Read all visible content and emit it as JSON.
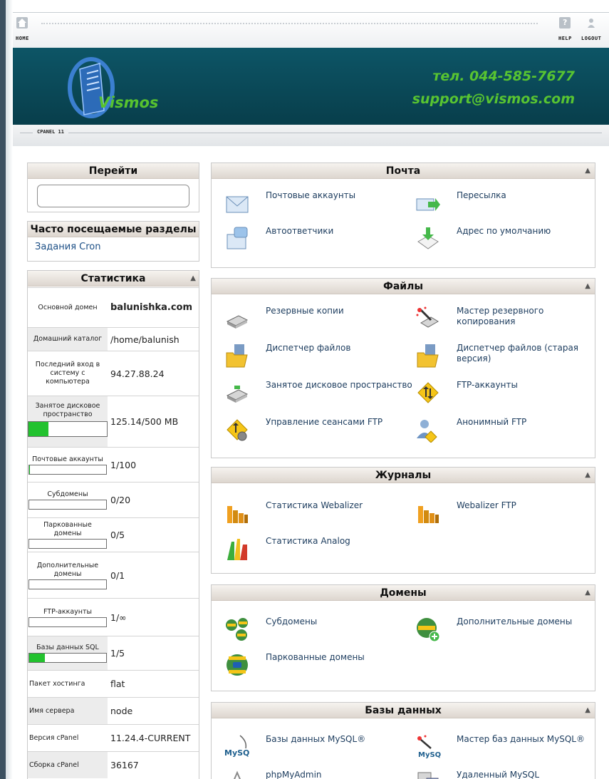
{
  "topbar": {
    "home_label": "HOME",
    "help_label": "HELP",
    "logout_label": "LOGOUT",
    "help_glyph": "?"
  },
  "banner": {
    "brand": "Vismos",
    "phone": "тел. 044-585-7677",
    "email": "support@vismos.com",
    "colors": {
      "background": "#0b4c5c",
      "accent": "#58c431"
    }
  },
  "cpanel_label": "CPANEL 11",
  "sidebar": {
    "goto": {
      "title": "Перейти",
      "input_value": ""
    },
    "frequent": {
      "title": "Часто посещаемые разделы",
      "link": "Задания Cron"
    },
    "stats": {
      "title": "Статистика",
      "rows": [
        {
          "label": "Основной домен",
          "value": "balunishka.com"
        },
        {
          "label": "Домашний каталог",
          "value": "/home/balunish"
        },
        {
          "label": "Последний вход в систему с компьютера",
          "value": "94.27.88.24"
        },
        {
          "label": "Занятое дисковое пространство",
          "value": "125.14/500 MB",
          "usage": 0.25
        },
        {
          "label": "Почтовые аккаунты",
          "value": "1/100",
          "usage": 0.01
        },
        {
          "label": "Субдомены",
          "value": "0/20",
          "usage": 0
        },
        {
          "label": "Паркованные домены",
          "value": "0/5",
          "usage": 0
        },
        {
          "label": "Дополнительные домены",
          "value": "0/1",
          "usage": 0
        },
        {
          "label": "FTP-аккаунты",
          "value": "1/∞",
          "usage": 0
        },
        {
          "label": "Базы данных SQL",
          "value": "1/5",
          "usage": 0.2
        },
        {
          "label": "Пакет хостинга",
          "value": "flat"
        },
        {
          "label": "Имя сервера",
          "value": "node"
        },
        {
          "label": "Версия cPanel",
          "value": "11.24.4-CURRENT"
        },
        {
          "label": "Сборка cPanel",
          "value": "36167"
        }
      ]
    }
  },
  "panels": {
    "mail": {
      "title": "Почта",
      "items": [
        {
          "label": "Почтовые аккаунты",
          "icon": "mail-accounts-icon"
        },
        {
          "label": "Пересылка",
          "icon": "forwarders-icon"
        },
        {
          "label": "Автоответчики",
          "icon": "autoresponders-icon"
        },
        {
          "label": "Адрес по умолчанию",
          "icon": "default-address-icon"
        }
      ]
    },
    "files": {
      "title": "Файлы",
      "items": [
        {
          "label": "Резервные копии",
          "icon": "backup-icon"
        },
        {
          "label": "Мастер резервного копирования",
          "icon": "backup-wizard-icon"
        },
        {
          "label": "Диспетчер файлов",
          "icon": "file-manager-icon"
        },
        {
          "label": "Диспетчер файлов (старая версия)",
          "icon": "file-manager-legacy-icon"
        },
        {
          "label": "Занятое дисковое пространство",
          "icon": "disk-usage-icon"
        },
        {
          "label": "FTP-аккаунты",
          "icon": "ftp-accounts-icon"
        },
        {
          "label": "Управление сеансами FTP",
          "icon": "ftp-sessions-icon"
        },
        {
          "label": "Анонимный FTP",
          "icon": "anonymous-ftp-icon"
        }
      ]
    },
    "logs": {
      "title": "Журналы",
      "items": [
        {
          "label": "Статистика Webalizer",
          "icon": "webalizer-icon"
        },
        {
          "label": "Webalizer FTP",
          "icon": "webalizer-ftp-icon"
        },
        {
          "label": "Статистика Analog",
          "icon": "analog-stats-icon"
        }
      ]
    },
    "domains": {
      "title": "Домены",
      "items": [
        {
          "label": "Субдомены",
          "icon": "subdomains-icon"
        },
        {
          "label": "Дополнительные домены",
          "icon": "addon-domains-icon"
        },
        {
          "label": "Паркованные домены",
          "icon": "parked-domains-icon"
        }
      ]
    },
    "databases": {
      "title": "Базы данных",
      "items": [
        {
          "label": "Базы данных MySQL®",
          "icon": "mysql-databases-icon",
          "icon_text": "MySQL"
        },
        {
          "label": "Мастер баз данных MySQL®",
          "icon": "mysql-wizard-icon",
          "icon_text": "MySQL"
        },
        {
          "label": "phpMyAdmin",
          "icon": "phpmyadmin-icon"
        },
        {
          "label": "Удаленный MySQL",
          "icon": "remote-mysql-icon"
        }
      ]
    }
  }
}
